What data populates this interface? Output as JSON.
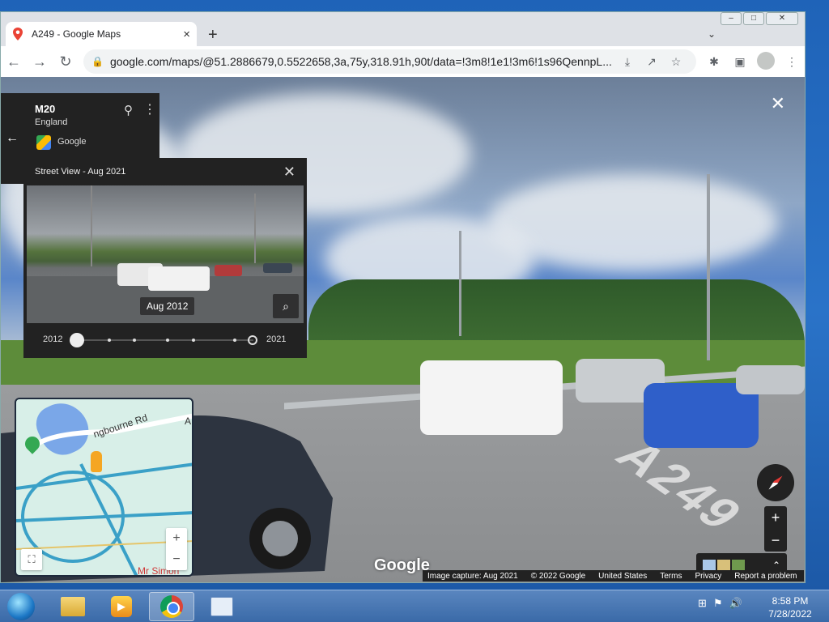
{
  "browser": {
    "tab_title": "A249 - Google Maps",
    "new_tab": "+",
    "tab_close": "×",
    "url": "google.com/maps/@51.2886679,0.5522658,3a,75y,318.91h,90t/data=!3m8!1e1!3m6!1s96QennpL...",
    "back": "←",
    "forward": "→",
    "reload": "↻"
  },
  "location_card": {
    "name": "M20",
    "region": "England",
    "provider": "Google"
  },
  "time_machine": {
    "title": "Street View - Aug 2021",
    "thumb_label": "Aug 2012",
    "year_start": "2012",
    "year_end": "2021"
  },
  "minimap": {
    "road_label": "ngbourne Rd",
    "edge_label": "A",
    "place_label": "Mr Simon"
  },
  "watermark": "Google",
  "road_marking": "A249",
  "footer": {
    "capture": "Image capture: Aug 2021",
    "copyright": "© 2022 Google",
    "country": "United States",
    "terms": "Terms",
    "privacy": "Privacy",
    "report": "Report a problem"
  },
  "taskbar": {
    "time": "8:58 PM",
    "date": "7/28/2022"
  },
  "colors": {
    "accent": "#1a73e8",
    "panel": "#222222"
  }
}
